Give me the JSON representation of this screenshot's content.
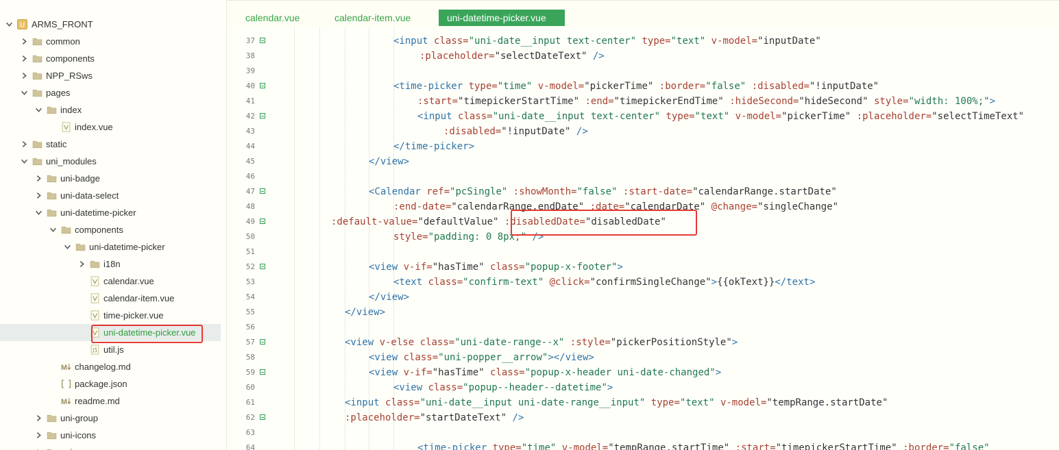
{
  "sidebar": {
    "root": {
      "label": "ARMS_FRONT"
    },
    "items": [
      {
        "label": "common",
        "type": "folder",
        "state": "collapsed"
      },
      {
        "label": "components",
        "type": "folder",
        "state": "collapsed"
      },
      {
        "label": "NPP_RSws",
        "type": "folder",
        "state": "collapsed"
      },
      {
        "label": "pages",
        "type": "folder",
        "state": "expanded"
      },
      {
        "label": "index",
        "type": "folder",
        "state": "expanded"
      },
      {
        "label": "index.vue",
        "type": "vue-file"
      },
      {
        "label": "static",
        "type": "folder",
        "state": "collapsed"
      },
      {
        "label": "uni_modules",
        "type": "folder",
        "state": "expanded"
      },
      {
        "label": "uni-badge",
        "type": "folder",
        "state": "collapsed"
      },
      {
        "label": "uni-data-select",
        "type": "folder",
        "state": "collapsed"
      },
      {
        "label": "uni-datetime-picker",
        "type": "folder",
        "state": "expanded"
      },
      {
        "label": "components",
        "type": "folder",
        "state": "expanded"
      },
      {
        "label": "uni-datetime-picker",
        "type": "folder",
        "state": "expanded"
      },
      {
        "label": "i18n",
        "type": "folder",
        "state": "collapsed"
      },
      {
        "label": "calendar.vue",
        "type": "vue-file"
      },
      {
        "label": "calendar-item.vue",
        "type": "vue-file"
      },
      {
        "label": "time-picker.vue",
        "type": "vue-file"
      },
      {
        "label": "uni-datetime-picker.vue",
        "type": "vue-file",
        "selected": true
      },
      {
        "label": "util.js",
        "type": "js-file"
      },
      {
        "label": "changelog.md",
        "type": "md-file"
      },
      {
        "label": "package.json",
        "type": "json-file"
      },
      {
        "label": "readme.md",
        "type": "md-file"
      },
      {
        "label": "uni-group",
        "type": "folder",
        "state": "collapsed"
      },
      {
        "label": "uni-icons",
        "type": "folder",
        "state": "collapsed"
      },
      {
        "label": "uni-...",
        "type": "folder",
        "state": "collapsed"
      }
    ]
  },
  "tabs": [
    {
      "label": "calendar.vue",
      "active": false
    },
    {
      "label": "calendar-item.vue",
      "active": false
    },
    {
      "label": "uni-datetime-picker.vue",
      "active": true
    }
  ],
  "editor": {
    "lines": [
      {
        "num": "37",
        "fold": true,
        "segs": [
          [
            "tag",
            "<input "
          ],
          [
            "attr",
            "class="
          ],
          [
            "str",
            "\"uni-date__input text-center\""
          ],
          [
            "txt",
            " "
          ],
          [
            "attr",
            "type="
          ],
          [
            "str",
            "\"text\""
          ],
          [
            "txt",
            " "
          ],
          [
            "attr",
            "v-model="
          ],
          [
            "txt",
            "\"inputDate\""
          ]
        ]
      },
      {
        "num": "38",
        "fold": false,
        "segs": [
          [
            "attr",
            ":placeholder="
          ],
          [
            "txt",
            "\"selectDateText\""
          ],
          [
            "txt",
            " "
          ],
          [
            "tag",
            "/>"
          ]
        ]
      },
      {
        "num": "39",
        "fold": false,
        "segs": []
      },
      {
        "num": "40",
        "fold": true,
        "segs": [
          [
            "tag",
            "<time-picker "
          ],
          [
            "attr",
            "type="
          ],
          [
            "str",
            "\"time\""
          ],
          [
            "txt",
            " "
          ],
          [
            "attr",
            "v-model="
          ],
          [
            "txt",
            "\"pickerTime\""
          ],
          [
            "txt",
            " "
          ],
          [
            "attr",
            ":border="
          ],
          [
            "str",
            "\"false\""
          ],
          [
            "txt",
            " "
          ],
          [
            "attr",
            ":disabled="
          ],
          [
            "txt",
            "\"!inputDate\""
          ]
        ]
      },
      {
        "num": "41",
        "fold": false,
        "segs": [
          [
            "attr",
            ":start="
          ],
          [
            "txt",
            "\"timepickerStartTime\""
          ],
          [
            "txt",
            " "
          ],
          [
            "attr",
            ":end="
          ],
          [
            "txt",
            "\"timepickerEndTime\""
          ],
          [
            "txt",
            " "
          ],
          [
            "attr",
            ":hideSecond="
          ],
          [
            "txt",
            "\"hideSecond\""
          ],
          [
            "txt",
            " "
          ],
          [
            "attr",
            "style="
          ],
          [
            "str",
            "\"width: 100%;\""
          ],
          [
            "tag",
            ">"
          ]
        ]
      },
      {
        "num": "42",
        "fold": true,
        "segs": [
          [
            "tag",
            "<input "
          ],
          [
            "attr",
            "class="
          ],
          [
            "str",
            "\"uni-date__input text-center\""
          ],
          [
            "txt",
            " "
          ],
          [
            "attr",
            "type="
          ],
          [
            "str",
            "\"text\""
          ],
          [
            "txt",
            " "
          ],
          [
            "attr",
            "v-model="
          ],
          [
            "txt",
            "\"pickerTime\""
          ],
          [
            "txt",
            " "
          ],
          [
            "attr",
            ":placeholder="
          ],
          [
            "txt",
            "\"selectTimeText\""
          ]
        ]
      },
      {
        "num": "43",
        "fold": false,
        "segs": [
          [
            "attr",
            ":disabled="
          ],
          [
            "txt",
            "\"!inputDate\""
          ],
          [
            "txt",
            " "
          ],
          [
            "tag",
            "/>"
          ]
        ]
      },
      {
        "num": "44",
        "fold": false,
        "segs": [
          [
            "tag",
            "</time-picker>"
          ]
        ]
      },
      {
        "num": "45",
        "fold": false,
        "segs": [
          [
            "tag",
            "</view>"
          ]
        ]
      },
      {
        "num": "46",
        "fold": false,
        "segs": []
      },
      {
        "num": "47",
        "fold": true,
        "segs": [
          [
            "tag",
            "<Calendar "
          ],
          [
            "attr",
            "ref="
          ],
          [
            "str",
            "\"pcSingle\""
          ],
          [
            "txt",
            " "
          ],
          [
            "attr",
            ":showMonth="
          ],
          [
            "str",
            "\"false\""
          ],
          [
            "txt",
            " "
          ],
          [
            "attr",
            ":start-date="
          ],
          [
            "txt",
            "\"calendarRange.startDate\""
          ]
        ]
      },
      {
        "num": "48",
        "fold": false,
        "segs": [
          [
            "attr",
            ":end-date="
          ],
          [
            "txt",
            "\"calendarRange.endDate\""
          ],
          [
            "txt",
            " "
          ],
          [
            "attr",
            ":date="
          ],
          [
            "txt",
            "\"calendarDate\""
          ],
          [
            "txt",
            " "
          ],
          [
            "attr",
            "@change="
          ],
          [
            "txt",
            "\"singleChange\""
          ]
        ]
      },
      {
        "num": "49",
        "fold": true,
        "segs": [
          [
            "attr",
            ":default-value="
          ],
          [
            "txt",
            "\"defaultValue\""
          ],
          [
            "txt",
            " "
          ],
          [
            "attr",
            ":disabledDate="
          ],
          [
            "txt",
            "\"disabledDate\""
          ]
        ]
      },
      {
        "num": "50",
        "fold": false,
        "segs": [
          [
            "attr",
            "style="
          ],
          [
            "str",
            "\"padding: 0 8px;\""
          ],
          [
            "txt",
            " "
          ],
          [
            "tag",
            "/>"
          ]
        ]
      },
      {
        "num": "51",
        "fold": false,
        "segs": []
      },
      {
        "num": "52",
        "fold": true,
        "segs": [
          [
            "tag",
            "<view "
          ],
          [
            "attr",
            "v-if="
          ],
          [
            "txt",
            "\"hasTime\""
          ],
          [
            "txt",
            " "
          ],
          [
            "attr",
            "class="
          ],
          [
            "str",
            "\"popup-x-footer\""
          ],
          [
            "tag",
            ">"
          ]
        ]
      },
      {
        "num": "53",
        "fold": false,
        "segs": [
          [
            "tag",
            "<text "
          ],
          [
            "attr",
            "class="
          ],
          [
            "str",
            "\"confirm-text\""
          ],
          [
            "txt",
            " "
          ],
          [
            "attr",
            "@click="
          ],
          [
            "txt",
            "\"confirmSingleChange\""
          ],
          [
            "tag",
            ">"
          ],
          [
            "txt",
            "{{okText}}"
          ],
          [
            "tag",
            "</text>"
          ]
        ]
      },
      {
        "num": "54",
        "fold": false,
        "segs": [
          [
            "tag",
            "</view>"
          ]
        ]
      },
      {
        "num": "55",
        "fold": false,
        "segs": [
          [
            "tag",
            "</view>"
          ]
        ]
      },
      {
        "num": "56",
        "fold": false,
        "segs": []
      },
      {
        "num": "57",
        "fold": true,
        "segs": [
          [
            "tag",
            "<view "
          ],
          [
            "attr",
            "v-else "
          ],
          [
            "attr",
            "class="
          ],
          [
            "str",
            "\"uni-date-range--x\""
          ],
          [
            "txt",
            " "
          ],
          [
            "attr",
            ":style="
          ],
          [
            "txt",
            "\"pickerPositionStyle\""
          ],
          [
            "tag",
            ">"
          ]
        ]
      },
      {
        "num": "58",
        "fold": false,
        "segs": [
          [
            "tag",
            "<view "
          ],
          [
            "attr",
            "class="
          ],
          [
            "str",
            "\"uni-popper__arrow\""
          ],
          [
            "tag",
            "></view>"
          ]
        ]
      },
      {
        "num": "59",
        "fold": true,
        "segs": [
          [
            "tag",
            "<view "
          ],
          [
            "attr",
            "v-if="
          ],
          [
            "txt",
            "\"hasTime\""
          ],
          [
            "txt",
            " "
          ],
          [
            "attr",
            "class="
          ],
          [
            "str",
            "\"popup-x-header uni-date-changed\""
          ],
          [
            "tag",
            ">"
          ]
        ]
      },
      {
        "num": "60",
        "fold": false,
        "segs": [
          [
            "tag",
            "<view "
          ],
          [
            "attr",
            "class="
          ],
          [
            "str",
            "\"popup--header--datetime\""
          ],
          [
            "tag",
            ">"
          ]
        ]
      },
      {
        "num": "61",
        "fold": false,
        "segs": [
          [
            "tag",
            "<input "
          ],
          [
            "attr",
            "class="
          ],
          [
            "str",
            "\"uni-date__input uni-date-range__input\""
          ],
          [
            "txt",
            " "
          ],
          [
            "attr",
            "type="
          ],
          [
            "str",
            "\"text\""
          ],
          [
            "txt",
            " "
          ],
          [
            "attr",
            "v-model="
          ],
          [
            "txt",
            "\"tempRange.startDate\""
          ]
        ]
      },
      {
        "num": "62",
        "fold": true,
        "segs": [
          [
            "attr",
            ":placeholder="
          ],
          [
            "txt",
            "\"startDateText\""
          ],
          [
            "txt",
            " "
          ],
          [
            "tag",
            "/>"
          ]
        ]
      },
      {
        "num": "63",
        "fold": false,
        "segs": []
      },
      {
        "num": "64",
        "fold": false,
        "segs": [
          [
            "tag",
            "<time-picker "
          ],
          [
            "attr",
            "type="
          ],
          [
            "str",
            "\"time\""
          ],
          [
            "txt",
            " "
          ],
          [
            "attr",
            "v-model="
          ],
          [
            "txt",
            "\"tempRange.startTime\""
          ],
          [
            "txt",
            " "
          ],
          [
            "attr",
            ":start="
          ],
          [
            "txt",
            "\"timepickerStartTime\""
          ],
          [
            "txt",
            " "
          ],
          [
            "attr",
            ":border="
          ],
          [
            "str",
            "\"false\""
          ]
        ]
      }
    ]
  },
  "colors": {
    "accent": "#3aa55a",
    "highlight_box": "#e53935",
    "folder_icon": "#cfc49a",
    "tag": "#2f73a6",
    "attr": "#a6412f",
    "string": "#20784f"
  }
}
